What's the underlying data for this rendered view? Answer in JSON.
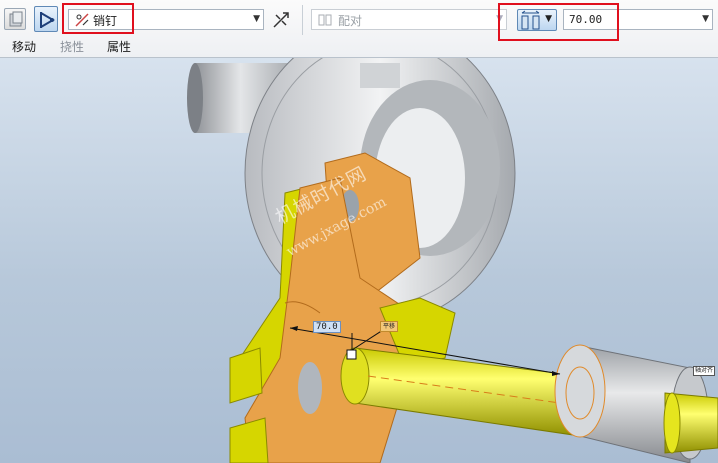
{
  "toolbar": {
    "constraint_type": {
      "value": "销钉",
      "icon": "pin-constraint-icon"
    },
    "alignment": {
      "value": "配对",
      "icon": "align-mate-icon"
    },
    "offset": {
      "value": "70.00",
      "icon": "offset-coincident-icon"
    },
    "tabs": [
      {
        "label": "移动",
        "enabled": true
      },
      {
        "label": "挠性",
        "enabled": false
      },
      {
        "label": "属性",
        "enabled": true
      }
    ]
  },
  "viewport": {
    "dimension_value": "70.0",
    "tag_left": "平移",
    "tag_right": "轴对齐",
    "watermark_cn": "机械时代网",
    "watermark_en": "www.jxage.com"
  },
  "colors": {
    "highlight_box": "#e0101e",
    "part_orange": "#e8a24a",
    "part_yellow": "#d6d600",
    "background": "#b7c8da"
  }
}
